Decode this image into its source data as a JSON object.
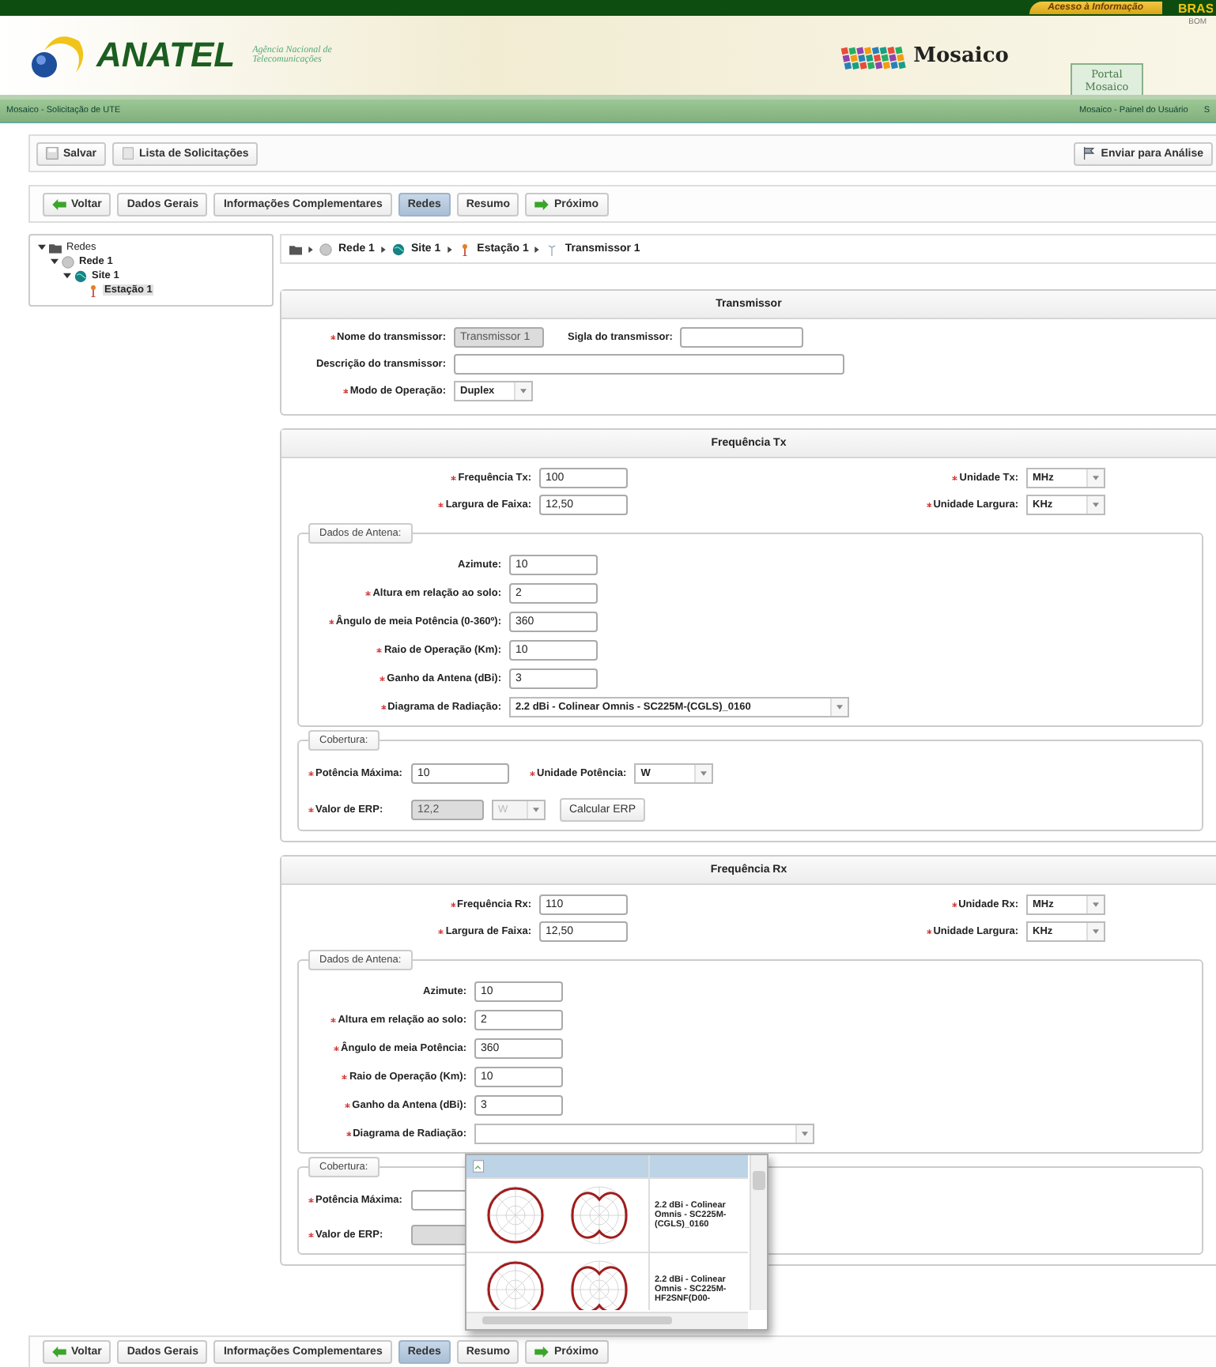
{
  "top_bar": {
    "access_link": "Acesso à Informação",
    "country_label": "BRAS",
    "sub_label": "BOM"
  },
  "header": {
    "logo_name": "ANATEL",
    "logo_subtitle": "Agência Nacional de Telecomunicações",
    "app_name": "Mosaico",
    "portal_tab": "Portal Mosaico"
  },
  "sub_bar": {
    "left": "Mosaico - Solicitação de UTE",
    "right": [
      "Mosaico - Painel do Usuário",
      "S"
    ]
  },
  "toolbar": {
    "buttons": [
      {
        "kind": "save",
        "label": "Salvar"
      },
      {
        "kind": "list",
        "label": "Lista de Solicitações"
      }
    ],
    "submit": "Enviar para Análise"
  },
  "tabs": [
    {
      "kind": "back",
      "label": "Voltar",
      "selected": false
    },
    {
      "kind": "plain",
      "label": "Dados Gerais",
      "selected": false
    },
    {
      "kind": "plain",
      "label": "Informações Complementares",
      "selected": false
    },
    {
      "kind": "plain",
      "label": "Redes",
      "selected": true
    },
    {
      "kind": "plain",
      "label": "Resumo",
      "selected": false
    },
    {
      "kind": "next",
      "label": "Próximo",
      "selected": false
    }
  ],
  "tree": [
    {
      "kind": "folder",
      "label": "Redes",
      "expanded": true,
      "selected": false,
      "children": [
        {
          "kind": "network",
          "label": "Rede 1",
          "expanded": true,
          "selected": false,
          "children": [
            {
              "kind": "site",
              "label": "Site 1",
              "expanded": true,
              "selected": false,
              "children": [
                {
                  "kind": "station",
                  "label": "Estação 1",
                  "selected": true
                }
              ]
            }
          ]
        }
      ]
    }
  ],
  "breadcrumb": [
    {
      "kind": "folder"
    },
    {
      "kind": "network",
      "label": "Rede 1"
    },
    {
      "kind": "site",
      "label": "Site 1"
    },
    {
      "kind": "station",
      "label": "Estação 1"
    },
    {
      "kind": "transmitter",
      "label": "Transmissor 1"
    }
  ],
  "transmitter_panel": {
    "title": "Transmissor",
    "rows": [
      [
        {
          "kind": "short_text",
          "label": "Nome do transmissor:",
          "value": "Transmissor  1",
          "required": true,
          "disabled": true
        },
        {
          "kind": "short_text",
          "label": "Sigla do transmissor:",
          "required": false,
          "disabled": false
        }
      ],
      [
        {
          "kind": "long_text",
          "label": "Descrição do transmissor:",
          "required": false,
          "disabled": false
        }
      ],
      [
        {
          "kind": "select",
          "label": "Modo de Operação:",
          "value": "Duplex",
          "required": true,
          "disabled": false
        }
      ]
    ]
  },
  "frequency_panels": [
    {
      "title": "Frequência Tx",
      "rows": [
        [
          {
            "kind": "short_text",
            "label": "Frequência Tx:",
            "value": "100",
            "required": true,
            "disabled": false
          },
          {
            "kind": "select",
            "label": "Unidade Tx:",
            "value": "MHz",
            "required": true,
            "disabled": false
          }
        ],
        [
          {
            "kind": "short_text",
            "label": "Largura de Faixa:",
            "value": "12,50",
            "required": true,
            "disabled": false
          },
          {
            "kind": "select",
            "label": "Unidade Largura:",
            "value": "KHz",
            "required": true,
            "disabled": false
          }
        ]
      ],
      "antenna": {
        "legend": "Dados de Antena:",
        "fields": [
          {
            "kind": "short_text",
            "label": "Azimute:",
            "value": "10",
            "required": false,
            "disabled": false
          },
          {
            "kind": "short_text",
            "label": "Altura em relação ao solo:",
            "value": "2",
            "required": true,
            "disabled": false
          },
          {
            "kind": "short_text",
            "label": "Ângulo de meia Potência (0-360º):",
            "value": "360",
            "required": true,
            "disabled": false
          },
          {
            "kind": "short_text",
            "label": "Raio de Operação (Km):",
            "value": "10",
            "required": true,
            "disabled": false
          },
          {
            "kind": "short_text",
            "label": "Ganho da Antena (dBi):",
            "value": "3",
            "required": true,
            "disabled": false
          },
          {
            "kind": "long_select",
            "label": "Diagrama de Radiação:",
            "value": "2.2 dBi - Colinear Omnis - SC225M-(CGLS)_0160",
            "required": true,
            "disabled": false
          }
        ]
      },
      "coverage": {
        "legend": "Cobertura:",
        "max_power": {
          "kind": "short_text",
          "label": "Potência Máxima:",
          "value": "10",
          "required": true,
          "disabled": false
        },
        "power_unit": {
          "kind": "select",
          "label": "Unidade Potência:",
          "value": "W",
          "required": true,
          "disabled": false
        },
        "erp": {
          "kind": "short_text",
          "label": "Valor de ERP:",
          "value": "12,2",
          "required": true,
          "disabled": true
        },
        "erp_unit": {
          "kind": "small_select",
          "value": "W",
          "disabled": true
        },
        "calculate_button": "Calcular ERP"
      }
    },
    {
      "title": "Frequência Rx",
      "rows": [
        [
          {
            "kind": "short_text",
            "label": "Frequência Rx:",
            "value": "110",
            "required": true,
            "disabled": false
          },
          {
            "kind": "select",
            "label": "Unidade Rx:",
            "value": "MHz",
            "required": true,
            "disabled": false
          }
        ],
        [
          {
            "kind": "short_text",
            "label": "Largura de Faixa:",
            "value": "12,50",
            "required": true,
            "disabled": false
          },
          {
            "kind": "select",
            "label": "Unidade Largura:",
            "value": "KHz",
            "required": true,
            "disabled": false
          }
        ]
      ],
      "antenna": {
        "legend": "Dados de Antena:",
        "fields": [
          {
            "kind": "short_text",
            "label": "Azimute:",
            "value": "10",
            "required": false,
            "disabled": false
          },
          {
            "kind": "short_text",
            "label": "Altura em relação ao solo:",
            "value": "2",
            "required": true,
            "disabled": false
          },
          {
            "kind": "short_text",
            "label": "Ângulo de meia Potência:",
            "value": "360",
            "required": true,
            "disabled": false
          },
          {
            "kind": "short_text",
            "label": "Raio de Operação (Km):",
            "value": "10",
            "required": true,
            "disabled": false
          },
          {
            "kind": "short_text",
            "label": "Ganho da Antena (dBi):",
            "value": "3",
            "required": true,
            "disabled": false
          },
          {
            "kind": "long_select",
            "label": "Diagrama de Radiação:",
            "required": true,
            "disabled": false
          }
        ]
      },
      "coverage": {
        "legend": "Cobertura:",
        "max_power": {
          "kind": "short_text",
          "label": "Potência Máxima:",
          "required": true,
          "disabled": false
        },
        "erp": {
          "kind": "short_text",
          "label": "Valor de ERP:",
          "required": true,
          "disabled": true
        }
      },
      "dropdown": {
        "options": [
          {
            "kind": "header",
            "selected": true
          },
          {
            "kind": "pattern",
            "text": "2.2 dBi - Colinear Omnis - SC225M-(CGLS)_0160",
            "selected": false
          },
          {
            "kind": "pattern",
            "text": "2.2 dBi - Colinear Omnis - SC225M-HF2SNF(D00-",
            "selected": false
          }
        ]
      }
    }
  ],
  "bottom_tabs": [
    {
      "kind": "back",
      "label": "Voltar",
      "selected": false
    },
    {
      "kind": "plain",
      "label": "Dados Gerais",
      "selected": false
    },
    {
      "kind": "plain",
      "label": "Informações Complementares",
      "selected": false
    },
    {
      "kind": "plain",
      "label": "Redes",
      "selected": true
    },
    {
      "kind": "plain",
      "label": "Resumo",
      "selected": false
    },
    {
      "kind": "next",
      "label": "Próximo",
      "selected": false
    }
  ]
}
